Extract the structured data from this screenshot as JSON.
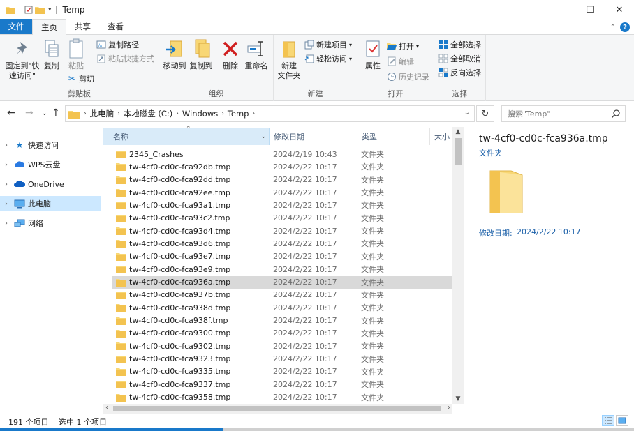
{
  "window": {
    "title": "Temp",
    "controls": {
      "minimize": "—",
      "maximize": "☐",
      "close": "✕"
    }
  },
  "ribbon_tabs": [
    {
      "label": "文件"
    },
    {
      "label": "主页"
    },
    {
      "label": "共享"
    },
    {
      "label": "查看"
    }
  ],
  "ribbon": {
    "clipboard": {
      "pin": "固定到\"快\n速访问\"",
      "copy": "复制",
      "paste": "粘贴",
      "copy_path": "复制路径",
      "paste_shortcut": "粘贴快捷方式",
      "cut": "剪切",
      "label": "剪贴板"
    },
    "organize": {
      "move_to": "移动到",
      "copy_to": "复制到",
      "delete": "删除",
      "rename": "重命名",
      "label": "组织"
    },
    "new": {
      "new_folder": "新建\n文件夹",
      "new_item": "新建项目",
      "easy_access": "轻松访问",
      "label": "新建"
    },
    "open": {
      "properties": "属性",
      "open": "打开",
      "edit": "编辑",
      "history": "历史记录",
      "label": "打开"
    },
    "select": {
      "select_all": "全部选择",
      "select_none": "全部取消",
      "invert": "反向选择",
      "label": "选择"
    }
  },
  "address": {
    "crumbs": [
      "此电脑",
      "本地磁盘 (C:)",
      "Windows",
      "Temp"
    ],
    "search_placeholder": "搜索\"Temp\""
  },
  "nav": [
    {
      "label": "快速访问",
      "icon": "star-icon"
    },
    {
      "label": "WPS云盘",
      "icon": "cloud-icon"
    },
    {
      "label": "OneDrive",
      "icon": "onedrive-icon"
    },
    {
      "label": "此电脑",
      "icon": "computer-icon",
      "selected": true
    },
    {
      "label": "网络",
      "icon": "network-icon"
    }
  ],
  "columns": {
    "name": "名称",
    "date": "修改日期",
    "type": "类型",
    "size": "大小"
  },
  "files": [
    {
      "name": "2345_Crashes",
      "date": "2024/2/19 10:43",
      "type": "文件夹"
    },
    {
      "name": "tw-4cf0-cd0c-fca92db.tmp",
      "date": "2024/2/22 10:17",
      "type": "文件夹"
    },
    {
      "name": "tw-4cf0-cd0c-fca92dd.tmp",
      "date": "2024/2/22 10:17",
      "type": "文件夹"
    },
    {
      "name": "tw-4cf0-cd0c-fca92ee.tmp",
      "date": "2024/2/22 10:17",
      "type": "文件夹"
    },
    {
      "name": "tw-4cf0-cd0c-fca93a1.tmp",
      "date": "2024/2/22 10:17",
      "type": "文件夹"
    },
    {
      "name": "tw-4cf0-cd0c-fca93c2.tmp",
      "date": "2024/2/22 10:17",
      "type": "文件夹"
    },
    {
      "name": "tw-4cf0-cd0c-fca93d4.tmp",
      "date": "2024/2/22 10:17",
      "type": "文件夹"
    },
    {
      "name": "tw-4cf0-cd0c-fca93d6.tmp",
      "date": "2024/2/22 10:17",
      "type": "文件夹"
    },
    {
      "name": "tw-4cf0-cd0c-fca93e7.tmp",
      "date": "2024/2/22 10:17",
      "type": "文件夹"
    },
    {
      "name": "tw-4cf0-cd0c-fca93e9.tmp",
      "date": "2024/2/22 10:17",
      "type": "文件夹"
    },
    {
      "name": "tw-4cf0-cd0c-fca936a.tmp",
      "date": "2024/2/22 10:17",
      "type": "文件夹",
      "selected": true
    },
    {
      "name": "tw-4cf0-cd0c-fca937b.tmp",
      "date": "2024/2/22 10:17",
      "type": "文件夹"
    },
    {
      "name": "tw-4cf0-cd0c-fca938d.tmp",
      "date": "2024/2/22 10:17",
      "type": "文件夹"
    },
    {
      "name": "tw-4cf0-cd0c-fca938f.tmp",
      "date": "2024/2/22 10:17",
      "type": "文件夹"
    },
    {
      "name": "tw-4cf0-cd0c-fca9300.tmp",
      "date": "2024/2/22 10:17",
      "type": "文件夹"
    },
    {
      "name": "tw-4cf0-cd0c-fca9302.tmp",
      "date": "2024/2/22 10:17",
      "type": "文件夹"
    },
    {
      "name": "tw-4cf0-cd0c-fca9323.tmp",
      "date": "2024/2/22 10:17",
      "type": "文件夹"
    },
    {
      "name": "tw-4cf0-cd0c-fca9335.tmp",
      "date": "2024/2/22 10:17",
      "type": "文件夹"
    },
    {
      "name": "tw-4cf0-cd0c-fca9337.tmp",
      "date": "2024/2/22 10:17",
      "type": "文件夹"
    },
    {
      "name": "tw-4cf0-cd0c-fca9358.tmp",
      "date": "2024/2/22 10:17",
      "type": "文件夹"
    }
  ],
  "preview": {
    "name": "tw-4cf0-cd0c-fca936a.tmp",
    "type": "文件夹",
    "date_label": "修改日期:",
    "date": "2024/2/22 10:17"
  },
  "status": {
    "count": "191 个项目",
    "selection": "选中 1 个项目"
  },
  "colors": {
    "accent": "#1979ca",
    "folder": "#f8d775",
    "selection": "#cce8ff",
    "row_selected": "#d9d9d9"
  }
}
